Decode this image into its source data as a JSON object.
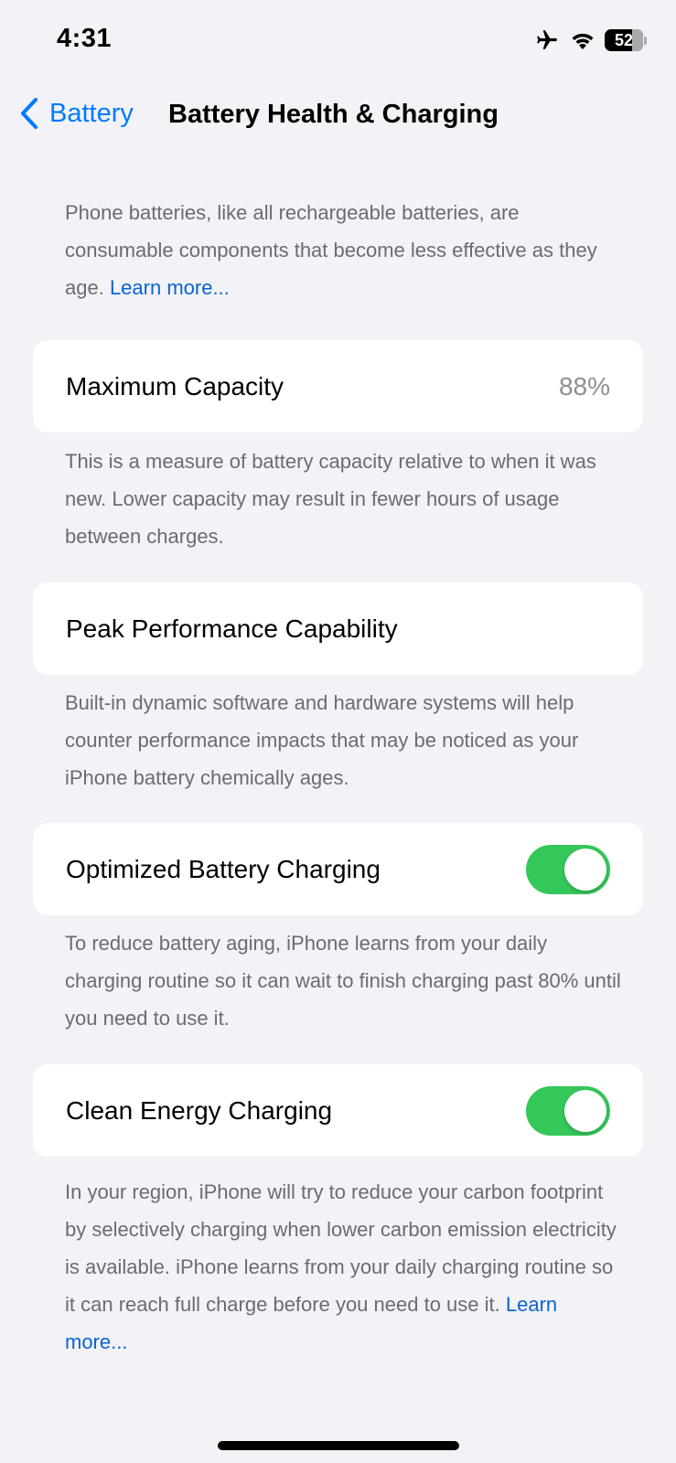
{
  "status_bar": {
    "time": "4:31",
    "battery_level": "52",
    "icons": [
      "airplane-icon",
      "wifi-icon",
      "battery-icon"
    ]
  },
  "nav": {
    "back_label": "Battery",
    "title": "Battery Health & Charging"
  },
  "intro": {
    "text": "Phone batteries, like all rechargeable batteries, are consumable components that become less effective as they age. ",
    "link": "Learn more..."
  },
  "sections": {
    "max_capacity": {
      "label": "Maximum Capacity",
      "value": "88%",
      "footnote": "This is a measure of battery capacity relative to when it was new. Lower capacity may result in fewer hours of usage between charges."
    },
    "peak_performance": {
      "label": "Peak Performance Capability",
      "footnote": "Built-in dynamic software and hardware systems will help counter performance impacts that may be noticed as your iPhone battery chemically ages."
    },
    "optimized_charging": {
      "label": "Optimized Battery Charging",
      "enabled": true,
      "footnote": "To reduce battery aging, iPhone learns from your daily charging routine so it can wait to finish charging past 80% until you need to use it."
    },
    "clean_energy": {
      "label": "Clean Energy Charging",
      "enabled": true,
      "footnote": "In your region, iPhone will try to reduce your carbon footprint by selectively charging when lower carbon emission electricity is available. iPhone learns from your daily charging routine so it can reach full charge before you need to use it. ",
      "link": "Learn more..."
    }
  },
  "colors": {
    "background": "#f2f2f7",
    "accent": "#007aff",
    "toggle_on": "#34c759",
    "secondary_text": "#6c6c70"
  }
}
